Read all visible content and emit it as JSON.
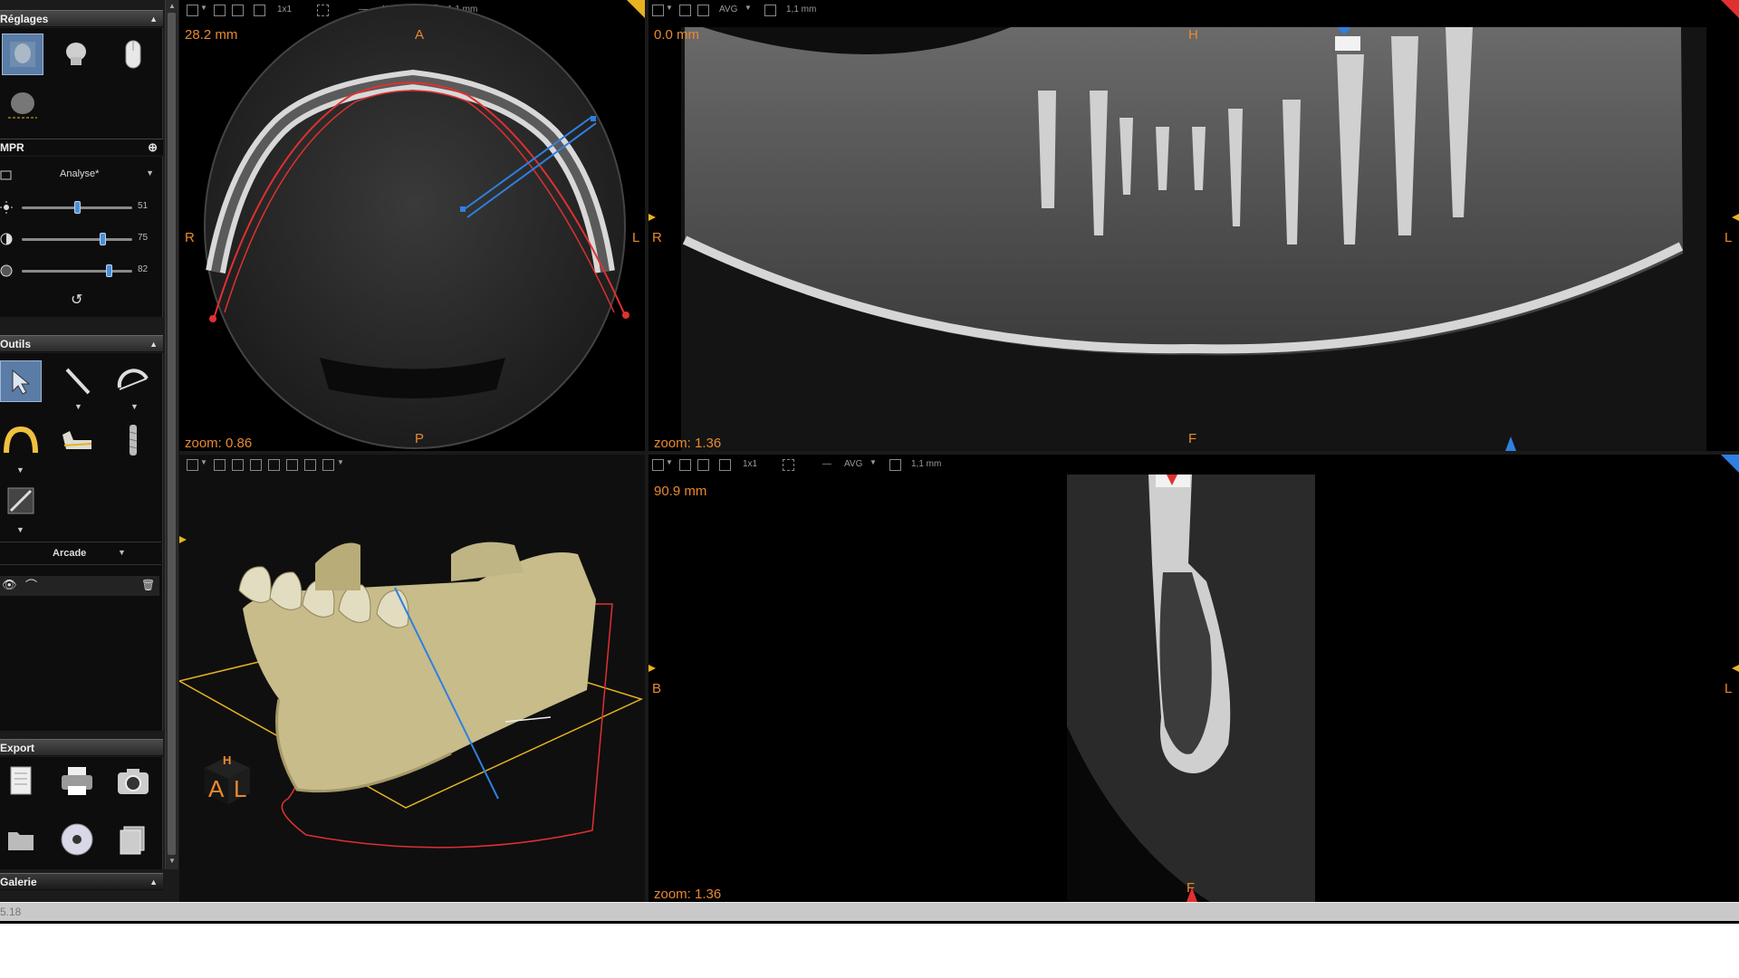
{
  "panel": {
    "settings_title": "Réglages",
    "mpr_label": "MPR",
    "preset_selected": "Analyse*",
    "sliders": [
      {
        "icon": "brightness-icon",
        "value": "51",
        "level": 0.5
      },
      {
        "icon": "contrast-icon",
        "value": "75",
        "level": 0.75
      },
      {
        "icon": "gamma-icon",
        "value": "82",
        "level": 0.82
      }
    ],
    "tools_title": "Outils",
    "arch_selected": "Arcade",
    "export_title": "Export",
    "gallery_title": "Galerie"
  },
  "toolbar": {
    "layout": "1x1",
    "projection": "AVG",
    "thickness": "1,1 mm"
  },
  "axial": {
    "depth": "28.2 mm",
    "zoom": "zoom: 0.86",
    "top": "A",
    "bottom": "P",
    "left": "R",
    "right": "L"
  },
  "panoramic": {
    "depth": "0.0 mm",
    "zoom": "zoom: 1.36",
    "top": "H",
    "bottom": "F",
    "left": "R",
    "right": "L"
  },
  "cross": {
    "depth": "90.9 mm",
    "zoom": "zoom: 1.36",
    "bottom": "F",
    "left": "B",
    "right": "L"
  },
  "volume": {
    "cube_top": "H",
    "cube_left": "A",
    "cube_right": "L"
  },
  "status": {
    "version": "5.18"
  },
  "colors": {
    "accent_blue": "#4c8dd6",
    "overlay_orange": "#e8892f",
    "arch_red": "#e03030",
    "cut_blue": "#2f80e0",
    "frame_yellow": "#e6b21f"
  }
}
